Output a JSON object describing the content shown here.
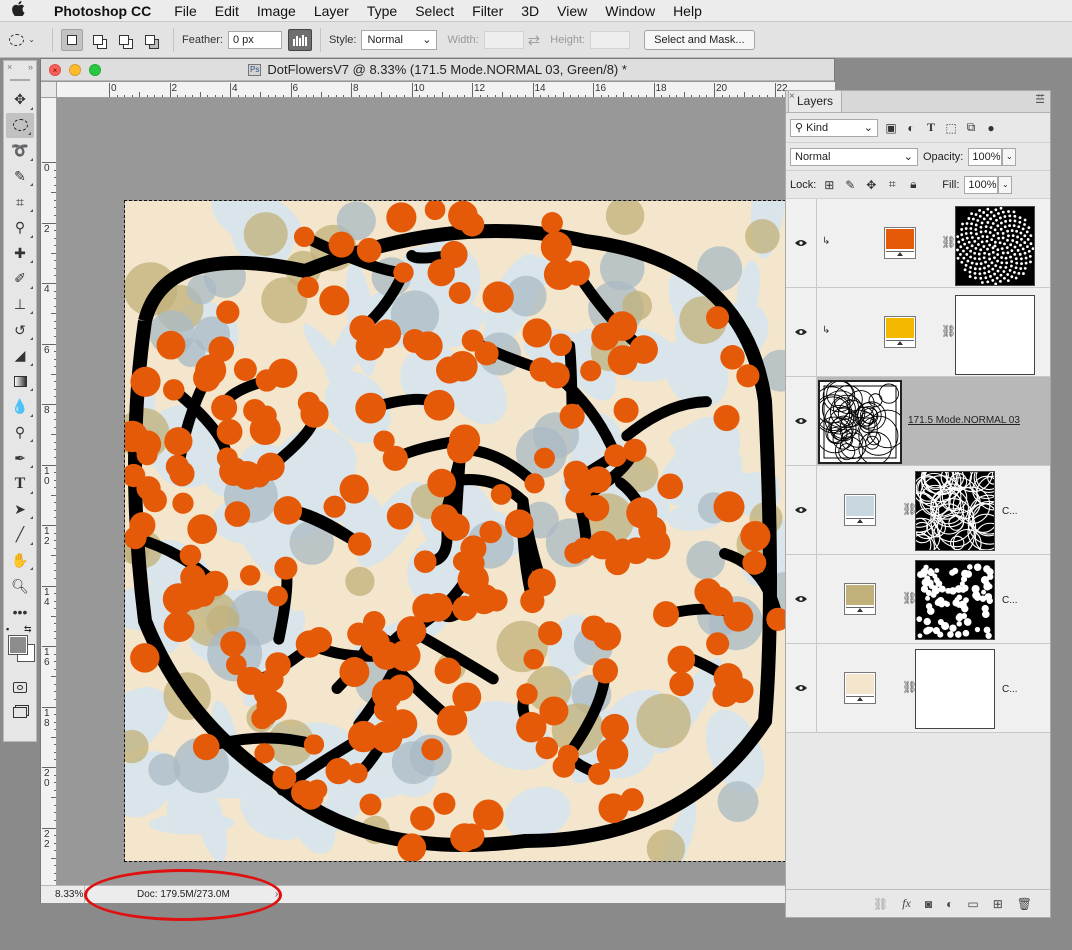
{
  "menubar": {
    "app": "Photoshop CC",
    "items": [
      "File",
      "Edit",
      "Image",
      "Layer",
      "Type",
      "Select",
      "Filter",
      "3D",
      "View",
      "Window",
      "Help"
    ]
  },
  "options": {
    "feather_label": "Feather:",
    "feather_value": "0 px",
    "style_label": "Style:",
    "style_value": "Normal",
    "width_label": "Width:",
    "height_label": "Height:",
    "mask_button": "Select and Mask..."
  },
  "tools": {
    "icons": [
      "move-icon",
      "ellipse-marquee-icon",
      "lasso-icon",
      "quick-select-icon",
      "crop-icon",
      "eyedropper-icon",
      "healing-brush-icon",
      "brush-icon",
      "stamp-icon",
      "history-brush-icon",
      "eraser-icon",
      "gradient-icon",
      "blur-icon",
      "dodge-icon",
      "pen-icon",
      "type-icon",
      "path-select-icon",
      "line-icon",
      "hand-icon",
      "zoom-icon",
      "more-tools-icon"
    ],
    "foreground_color": "#8c8c8c",
    "background_color": "#ffffff"
  },
  "document": {
    "title": "DotFlowersV7 @ 8.33% (171.5 Mode.NORMAL 03, Green/8) *",
    "ruler_h": [
      "0",
      "2",
      "4",
      "6",
      "8",
      "10",
      "12",
      "14",
      "16",
      "18",
      "20",
      "22"
    ],
    "ruler_v": [
      "0",
      "2",
      "4",
      "6",
      "8",
      "1 0",
      "1 2",
      "1 4",
      "1 6",
      "1 8",
      "2 0",
      "2 2"
    ],
    "zoom": "8.33%",
    "doc_size": "Doc: 179.5M/273.0M",
    "palette": {
      "cream": "#f3e6cc",
      "lightblue": "#d9e5ea",
      "slateblue": "#a9b9c4",
      "khaki": "#c2b07a",
      "orange": "#e45a09",
      "black": "#000000"
    }
  },
  "layers_panel": {
    "tab": "Layers",
    "filter_kind": "Kind",
    "blend_mode": "Normal",
    "opacity_label": "Opacity:",
    "opacity": "100%",
    "lock_label": "Lock:",
    "fill_label": "Fill:",
    "fill": "100%",
    "layers": [
      {
        "fill": "#e45a09",
        "clipped": true,
        "name": "",
        "mask": "dots-spiral"
      },
      {
        "fill": "#f5b800",
        "clipped": true,
        "name": "",
        "mask": "white"
      },
      {
        "fill": "",
        "clipped": false,
        "name": "171.5 Mode.NORMAL 03",
        "mask": "circles"
      },
      {
        "fill": "#c9d8e0",
        "clipped": false,
        "name": "C...",
        "mask": "web"
      },
      {
        "fill": "#c2b07a",
        "clipped": false,
        "name": "C...",
        "mask": "dots"
      },
      {
        "fill": "#f3e6cc",
        "clipped": false,
        "name": "C...",
        "mask": "white"
      }
    ]
  }
}
